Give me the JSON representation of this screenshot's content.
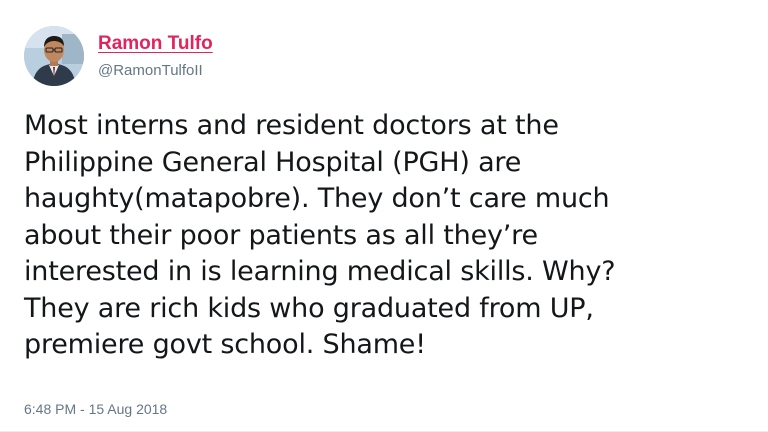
{
  "author": {
    "name": "Ramon Tulfo",
    "handle": "@RamonTulfoII"
  },
  "tweet": {
    "lines": [
      "Most interns and resident doctors at the",
      "Philippine General Hospital (PGH) are",
      "haughty(matapobre). They don’t care much",
      "about their poor patients as all they’re",
      "interested in is learning medical skills. Why?",
      "They are rich kids who graduated from UP,",
      "premiere govt school. Shame!"
    ],
    "timestamp": "6:48 PM - 15 Aug 2018"
  },
  "colors": {
    "name_link": "#e0245e",
    "secondary_text": "#657786",
    "body_text": "#14171a"
  },
  "icons": {
    "avatar": "profile-photo-man-in-suit"
  }
}
